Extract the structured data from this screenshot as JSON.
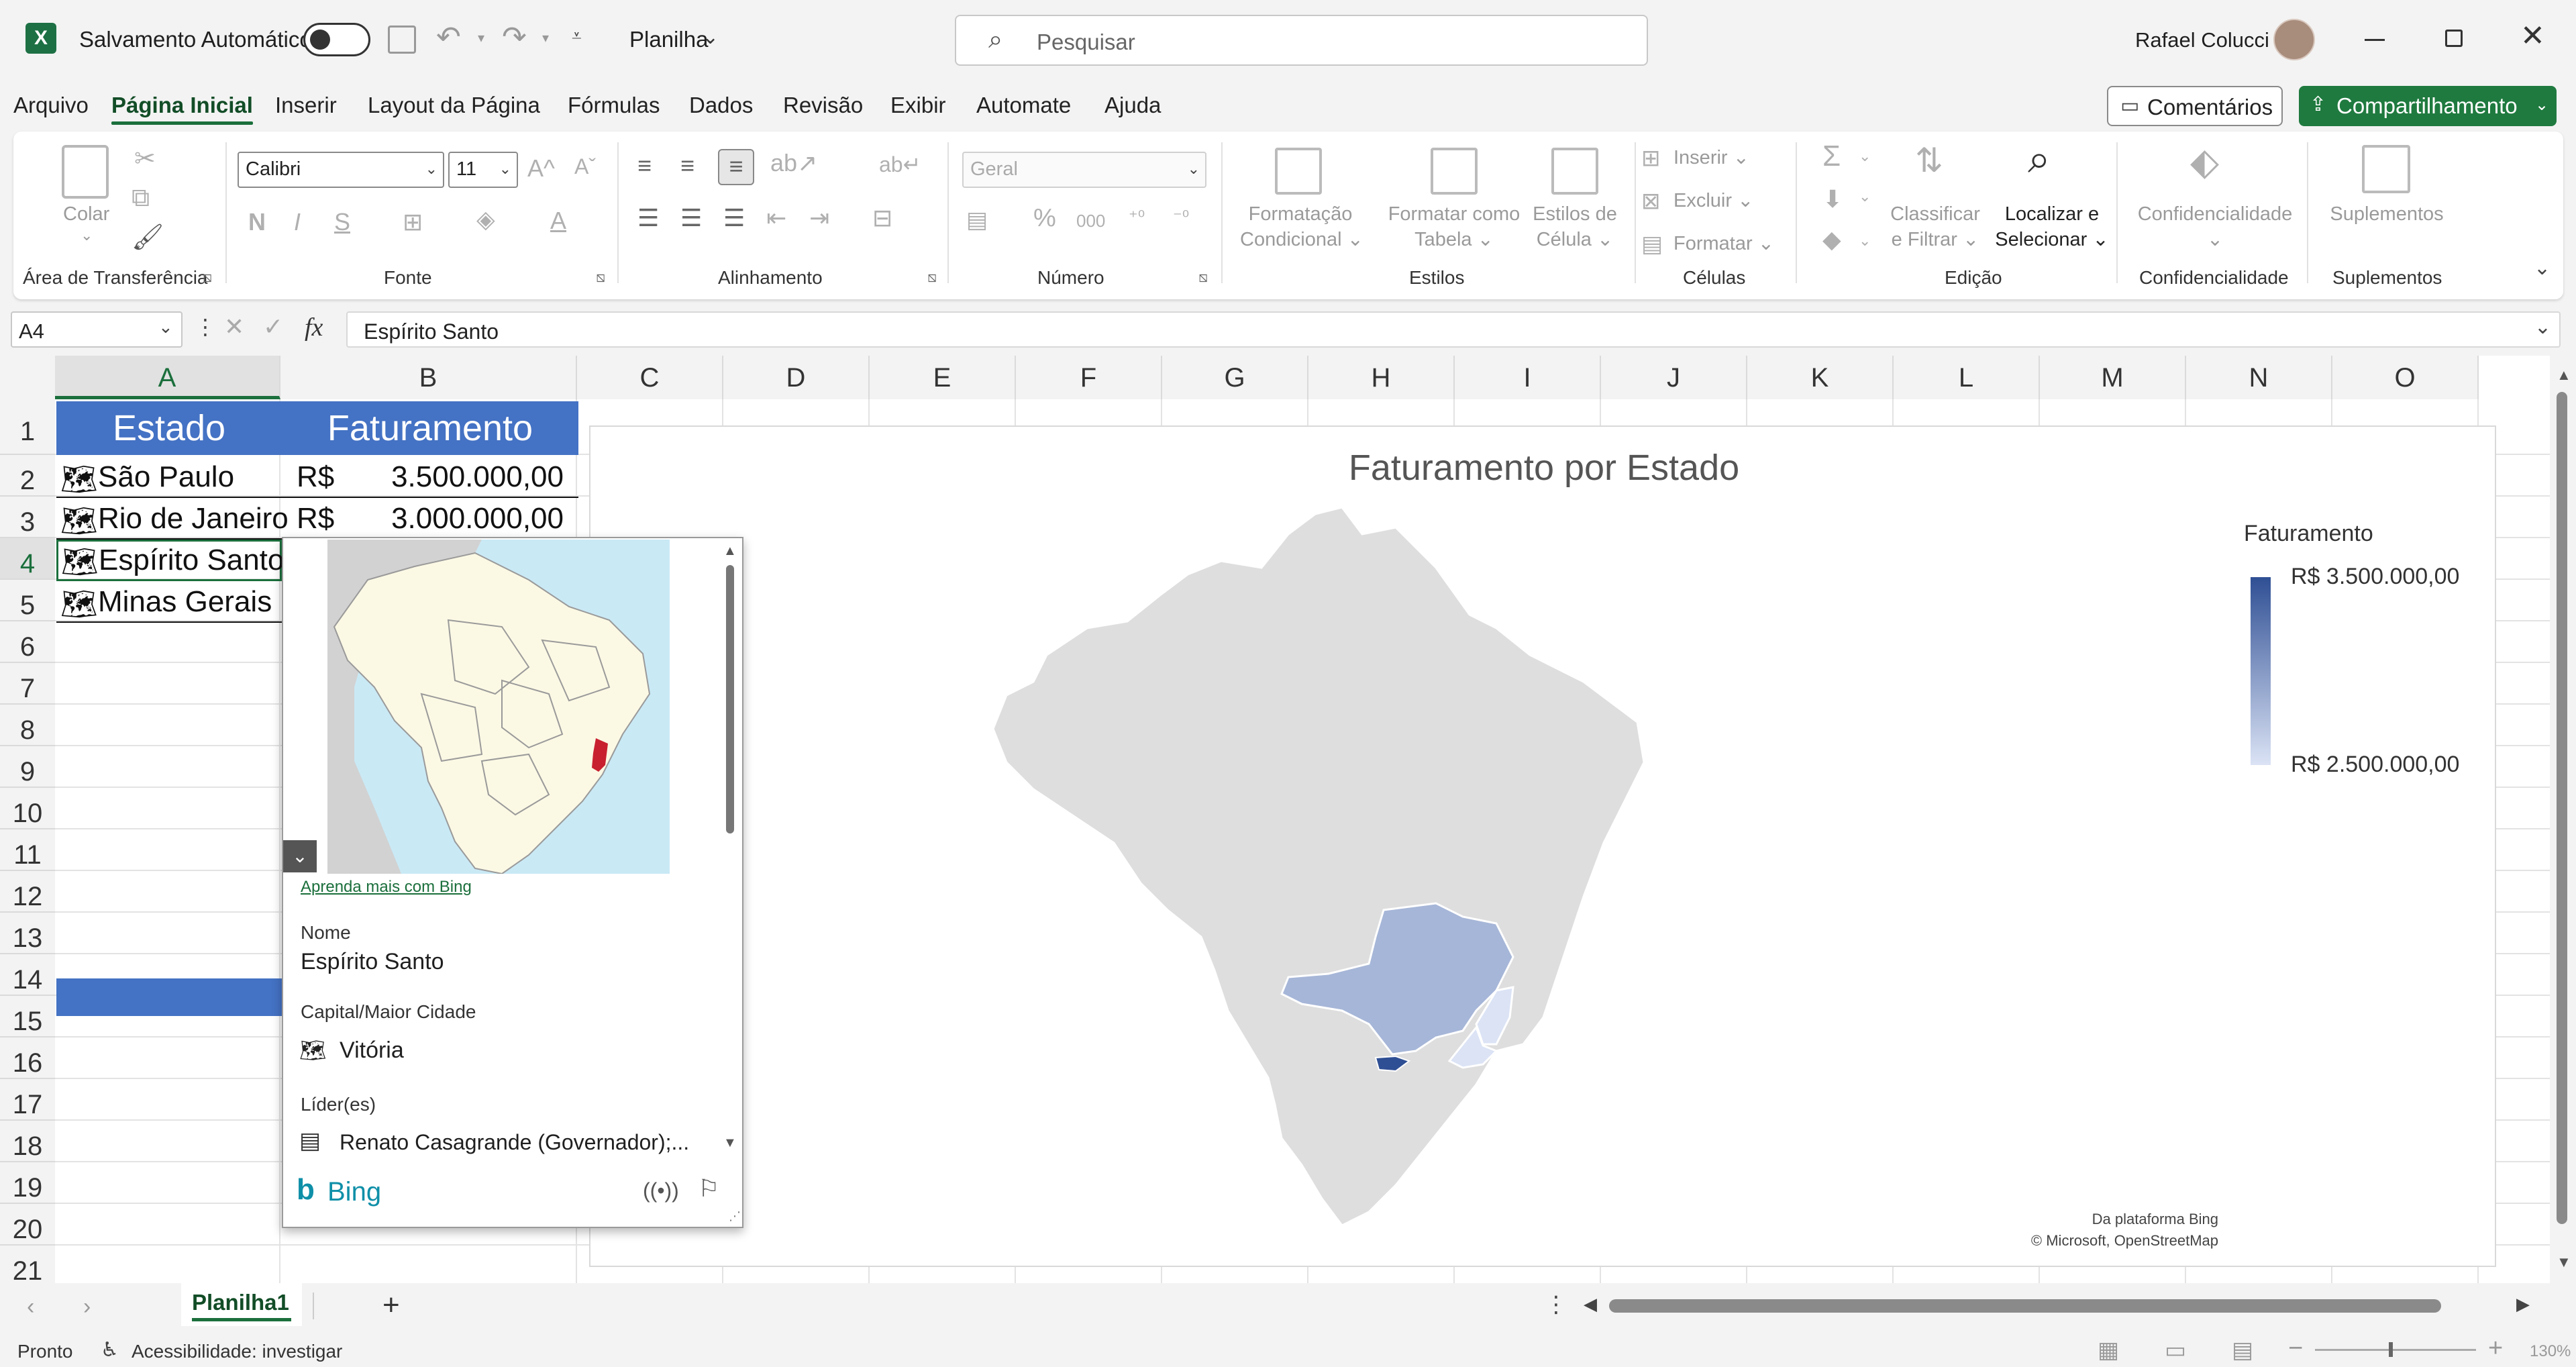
{
  "titlebar": {
    "autosave_label": "Salvamento Automático",
    "file_name": "Planilha",
    "search_placeholder": "Pesquisar",
    "user_name": "Rafael Colucci"
  },
  "menu": {
    "items": [
      "Arquivo",
      "Página Inicial",
      "Inserir",
      "Layout da Página",
      "Fórmulas",
      "Dados",
      "Revisão",
      "Exibir",
      "Automate",
      "Ajuda"
    ],
    "comments_label": "Comentários",
    "share_label": "Compartilhamento"
  },
  "ribbon": {
    "groups": [
      "Área de Transferência",
      "Fonte",
      "Alinhamento",
      "Número",
      "Estilos",
      "Células",
      "Edição",
      "Confidencialidade",
      "Suplementos"
    ],
    "paste_label": "Colar",
    "font_name": "Calibri",
    "font_size": "11",
    "number_format": "Geral",
    "conditional_format_line1": "Formatação",
    "conditional_format_line2": "Condicional",
    "format_table_line1": "Formatar como",
    "format_table_line2": "Tabela",
    "cell_styles_line1": "Estilos de",
    "cell_styles_line2": "Célula",
    "insert_label": "Inserir",
    "delete_label": "Excluir",
    "format_label": "Formatar",
    "sort_filter_line1": "Classificar",
    "sort_filter_line2": "e Filtrar",
    "find_select_line1": "Localizar e",
    "find_select_line2": "Selecionar",
    "sensitivity_label": "Confidencialidade",
    "addins_label": "Suplementos"
  },
  "formula_bar": {
    "name_box": "A4",
    "fx_label": "fx",
    "content": "Espírito Santo"
  },
  "grid": {
    "columns": [
      "A",
      "B",
      "C",
      "D",
      "E",
      "F",
      "G",
      "H",
      "I",
      "J",
      "K",
      "L",
      "M",
      "N",
      "O"
    ],
    "rows": [
      "1",
      "2",
      "3",
      "4",
      "5",
      "6",
      "7",
      "8",
      "9",
      "10",
      "11",
      "12",
      "13",
      "14",
      "15",
      "16",
      "17",
      "18",
      "19",
      "20",
      "21"
    ],
    "header_estado": "Estado",
    "header_faturamento": "Faturamento",
    "data": [
      {
        "estado": "São Paulo",
        "currency": "R$",
        "value": "3.500.000,00"
      },
      {
        "estado": "Rio de Janeiro",
        "currency": "R$",
        "value": "3.000.000,00"
      },
      {
        "estado": "Espírito Santo",
        "currency": "",
        "value": ""
      },
      {
        "estado": "Minas Gerais",
        "currency": "",
        "value": ""
      }
    ]
  },
  "card": {
    "learn_more": "Aprenda mais com Bing",
    "name_label": "Nome",
    "name_value": "Espírito Santo",
    "capital_label": "Capital/Maior Cidade",
    "capital_value": "Vitória",
    "leaders_label": "Líder(es)",
    "leaders_value": "Renato Casagrande (Governador);...",
    "brand": "Bing"
  },
  "chart": {
    "title": "Faturamento por Estado",
    "legend_title": "Faturamento",
    "legend_max": "R$ 3.500.000,00",
    "legend_min": "R$ 2.500.000,00",
    "credit_line1": "Da plataforma Bing",
    "credit_line2": "© Microsoft, OpenStreetMap",
    "colors": {
      "base": "#dedede",
      "low": "#dbe3f5",
      "mid": "#a6b6d8",
      "high": "#2f4f94"
    }
  },
  "chart_data": {
    "type": "map",
    "title": "Faturamento por Estado",
    "legend_title": "Faturamento",
    "color_scale_min": 2500000,
    "color_scale_max": 3500000,
    "regions": [
      {
        "name": "São Paulo",
        "value": 3500000
      },
      {
        "name": "Rio de Janeiro",
        "value": 3000000
      },
      {
        "name": "Espírito Santo",
        "value": null
      },
      {
        "name": "Minas Gerais",
        "value": null
      }
    ]
  },
  "sheet_tabs": {
    "active": "Planilha1",
    "add_label": "+"
  },
  "status": {
    "ready": "Pronto",
    "accessibility": "Acessibilidade: investigar",
    "zoom": "130%"
  }
}
